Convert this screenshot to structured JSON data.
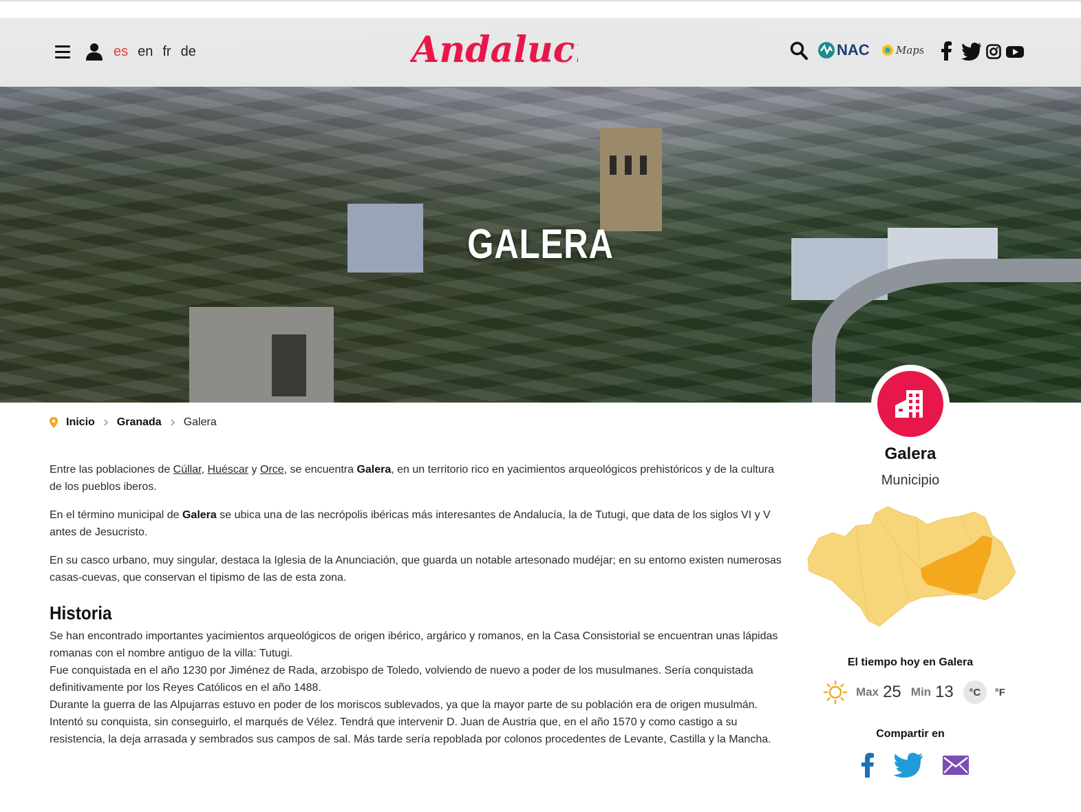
{
  "header": {
    "languages": [
      {
        "code": "es",
        "active": true
      },
      {
        "code": "en",
        "active": false
      },
      {
        "code": "fr",
        "active": false
      },
      {
        "code": "de",
        "active": false
      }
    ],
    "logo_text": "Andalucía",
    "icons": [
      "menu-icon",
      "user-icon",
      "search-icon",
      "nac-logo",
      "maps-logo",
      "facebook-icon",
      "twitter-icon",
      "instagram-icon",
      "youtube-icon"
    ],
    "nac_label": "NAC",
    "maps_label": "Maps"
  },
  "hero": {
    "title": "GALERA"
  },
  "breadcrumb": {
    "items": [
      "Inicio",
      "Granada",
      "Galera"
    ]
  },
  "content": {
    "p1": {
      "t1": "Entre las poblaciones de ",
      "link1": "Cúllar",
      "t2": ", ",
      "link2": "Huéscar",
      "t3": " y ",
      "link3": "Orce",
      "t4": ", se encuentra ",
      "bold": "Galera",
      "t5": ", en un territorio rico en yacimientos arqueológicos prehistóricos y de la cultura de los pueblos iberos."
    },
    "p2": {
      "t1": "En el término municipal de ",
      "bold": "Galera",
      "t2": " se ubica una de las necrópolis ibéricas más interesantes de Andalucía, la de Tutugi, que data de los siglos VI y V antes de Jesucristo."
    },
    "p3": "En su casco urbano, muy singular, destaca la Iglesia de la Anunciación, que guarda un notable artesonado mudéjar; en su entorno existen numerosas casas-cuevas, que conservan el tipismo de las de esta zona.",
    "history_heading": "Historia",
    "history": [
      "Se han encontrado importantes yacimientos arqueológicos de origen ibérico, argárico y romanos, en la Casa Consistorial se encuentran unas lápidas romanas con el nombre antiguo de la villa: Tutugi.",
      "Fue conquistada en el año 1230 por Jiménez de Rada, arzobispo de Toledo, volviendo de nuevo a poder de los musulmanes. Sería conquistada definitivamente por los Reyes Católicos en el año 1488.",
      "Durante la guerra de las Alpujarras estuvo en poder de los moriscos sublevados, ya que la mayor parte de su población era de origen musulmán. Intentó su conquista, sin conseguirlo, el marqués de Vélez. Tendrá que intervenir D. Juan de Austria que, en el año 1570 y como castigo a su resistencia, la deja arrasada y sembrados sus campos de sal. Más tarde sería repoblada por colonos procedentes de Levante, Castilla y la Mancha."
    ]
  },
  "sidebar": {
    "title": "Galera",
    "subtitle": "Municipio",
    "weather_title": "El tiempo hoy en Galera",
    "max_label": "Max",
    "max_value": "25",
    "min_label": "Min",
    "min_value": "13",
    "unit_c": "°C",
    "unit_f": "°F",
    "share_title": "Compartir en"
  },
  "colors": {
    "accent_red": "#e8174a",
    "lang_active": "#e63a3a",
    "map_base": "#f7d57a",
    "map_highlight": "#f4a81d",
    "breadcrumb_pin": "#f4a81d"
  }
}
